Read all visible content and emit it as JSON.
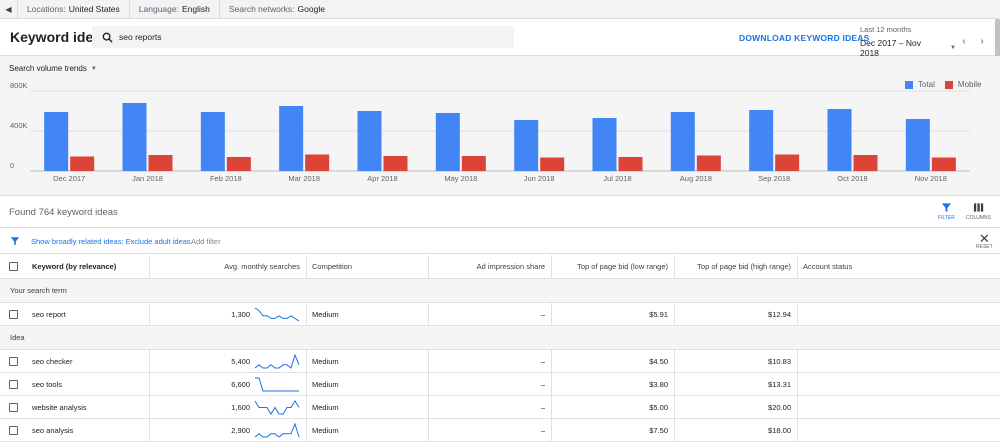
{
  "topbar": {
    "locations_label": "Locations:",
    "locations_value": "United States",
    "language_label": "Language:",
    "language_value": "English",
    "networks_label": "Search networks:",
    "networks_value": "Google"
  },
  "header": {
    "title": "Keyword ideas",
    "search_value": "seo reports",
    "download_label": "DOWNLOAD KEYWORD IDEAS",
    "date_label": "Last 12 months",
    "date_value": "Dec 2017 – Nov 2018"
  },
  "chart_controls": {
    "trend_select": "Search volume trends"
  },
  "chart_data": {
    "type": "bar",
    "categories": [
      "Dec 2017",
      "Jan 2018",
      "Feb 2018",
      "Mar 2018",
      "Apr 2018",
      "May 2018",
      "Jun 2018",
      "Jul 2018",
      "Aug 2018",
      "Sep 2018",
      "Oct 2018",
      "Nov 2018"
    ],
    "series": [
      {
        "name": "Total",
        "color": "#4285f4",
        "values": [
          590000,
          680000,
          590000,
          650000,
          600000,
          580000,
          510000,
          530000,
          590000,
          610000,
          620000,
          520000
        ]
      },
      {
        "name": "Mobile",
        "color": "#db4437",
        "values": [
          145000,
          160000,
          140000,
          165000,
          150000,
          150000,
          135000,
          140000,
          155000,
          165000,
          160000,
          135000
        ]
      }
    ],
    "y_ticks": [
      "0",
      "400K",
      "800K"
    ],
    "ylim": [
      0,
      800000
    ],
    "legend_position": "top-right",
    "grid": true
  },
  "results": {
    "found_text": "Found 764 keyword ideas",
    "filter_label": "FILTER",
    "columns_label": "COLUMNS",
    "applied_filters": "Show broadly related ideas; Exclude adult ideas",
    "add_filter": "Add filter",
    "reset_label": "RESET"
  },
  "table": {
    "headers": {
      "keyword": "Keyword (by relevance)",
      "avg": "Avg. monthly searches",
      "competition": "Competition",
      "impression": "Ad impression share",
      "low_bid": "Top of page bid (low range)",
      "high_bid": "Top of page bid (high range)",
      "status": "Account status"
    },
    "group_search_term": "Your search term",
    "search_term_rows": [
      {
        "keyword": "seo report",
        "avg": "1,300",
        "competition": "Medium",
        "impression": "–",
        "low": "$5.91",
        "high": "$12.94",
        "spark": [
          6,
          5,
          3,
          3,
          2,
          2,
          3,
          2,
          2,
          3,
          2,
          1
        ]
      }
    ],
    "group_idea": "Idea",
    "idea_rows": [
      {
        "keyword": "seo checker",
        "avg": "5,400",
        "competition": "Medium",
        "impression": "–",
        "low": "$4.50",
        "high": "$10.83",
        "spark": [
          2,
          3,
          2,
          2,
          3,
          2,
          2,
          3,
          3,
          2,
          6,
          3
        ]
      },
      {
        "keyword": "seo tools",
        "avg": "6,600",
        "competition": "Medium",
        "impression": "–",
        "low": "$3.80",
        "high": "$13.31",
        "spark": [
          7,
          7,
          2,
          2,
          2,
          2,
          2,
          2,
          2,
          2,
          2,
          2
        ]
      },
      {
        "keyword": "website analysis",
        "avg": "1,600",
        "competition": "Medium",
        "impression": "–",
        "low": "$5.00",
        "high": "$20.00",
        "spark": [
          6,
          4,
          4,
          4,
          2,
          4,
          2,
          2,
          4,
          4,
          6,
          4
        ]
      },
      {
        "keyword": "seo analysis",
        "avg": "2,900",
        "competition": "Medium",
        "impression": "–",
        "low": "$7.50",
        "high": "$18.00",
        "spark": [
          2,
          3,
          2,
          2,
          3,
          3,
          2,
          3,
          3,
          3,
          6,
          2
        ]
      }
    ]
  }
}
